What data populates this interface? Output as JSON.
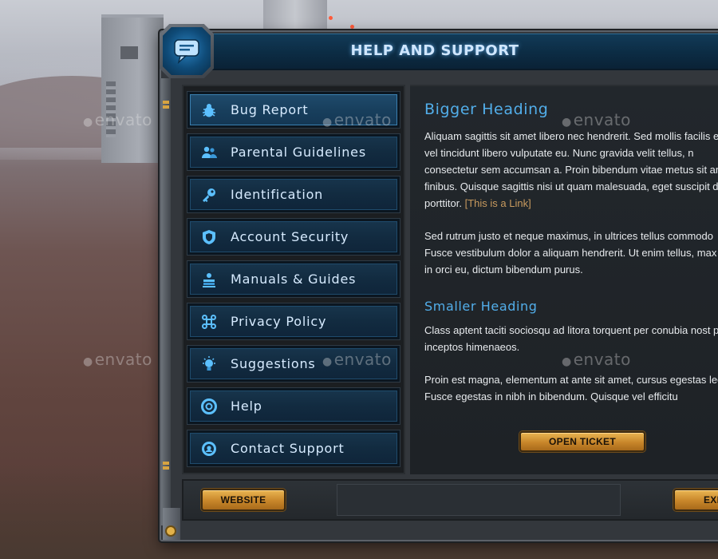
{
  "window": {
    "title": "HELP AND SUPPORT"
  },
  "menu": {
    "items": [
      {
        "label": "Bug Report",
        "icon": "bug-icon",
        "active": true
      },
      {
        "label": "Parental Guidelines",
        "icon": "people-icon",
        "active": false
      },
      {
        "label": "Identification",
        "icon": "key-icon",
        "active": false
      },
      {
        "label": "Account Security",
        "icon": "shield-icon",
        "active": false
      },
      {
        "label": "Manuals & Guides",
        "icon": "manual-icon",
        "active": false
      },
      {
        "label": "Privacy Policy",
        "icon": "command-icon",
        "active": false
      },
      {
        "label": "Suggestions",
        "icon": "lightbulb-icon",
        "active": false
      },
      {
        "label": "Help",
        "icon": "lifebuoy-icon",
        "active": false
      },
      {
        "label": "Contact Support",
        "icon": "headset-icon",
        "active": false
      }
    ]
  },
  "content": {
    "heading": "Bigger Heading",
    "paragraph1": "Aliquam sagittis sit amet libero nec hendrerit. Sed mollis facilis elit, vel tincidunt libero vulputate eu. Nunc gravida velit tellus, n consectetur sem accumsan a. Proin bibendum vitae metus sit amet finibus. Quisque sagittis nisi ut quam malesuada, eget suscipit dui porttitor.",
    "link_text": "[This is a Link]",
    "paragraph2": "Sed rutrum justo et neque maximus, in ultrices tellus commodo Fusce vestibulum dolor a aliquam hendrerit. Ut enim tellus, max mus in orci eu, dictum bibendum purus.",
    "subheading": "Smaller Heading",
    "paragraph3": "Class aptent taciti sociosqu ad litora torquent per conubia nost per inceptos himenaeos.",
    "paragraph4": "Proin est magna, elementum at ante sit amet, cursus egestas lectus. Fusce egestas in nibh in bibendum. Quisque vel efficitu",
    "open_ticket_label": "OPEN TICKET"
  },
  "footer": {
    "website_label": "WEBSITE",
    "exit_label": "EXI"
  },
  "watermarks": [
    "envato",
    "envato",
    "envato",
    "envato",
    "envato",
    "envato",
    "envato",
    "envato"
  ],
  "colors": {
    "accent_blue": "#52aeea",
    "title_glow": "#cfe6ff",
    "button_gold": "#c8862a",
    "link_color": "#c89a5e"
  }
}
